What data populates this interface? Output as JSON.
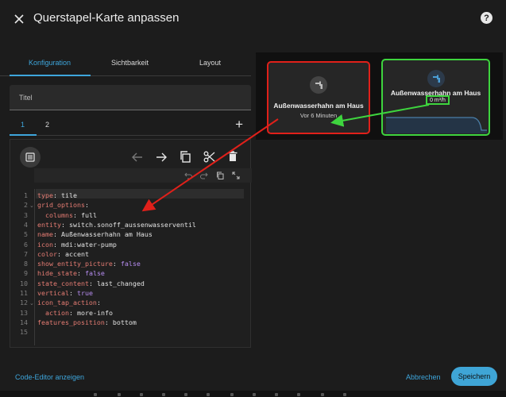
{
  "dialog": {
    "title": "Querstapel-Karte anpassen",
    "close_icon": "close-icon",
    "help_icon": "help-icon",
    "help_glyph": "?"
  },
  "tabs": [
    {
      "label": "Konfiguration",
      "active": true
    },
    {
      "label": "Sichtbarkeit",
      "active": false
    },
    {
      "label": "Layout",
      "active": false
    }
  ],
  "title_field": {
    "label": "Titel",
    "value": ""
  },
  "subtabs": [
    {
      "label": "1",
      "active": true
    },
    {
      "label": "2",
      "active": false
    }
  ],
  "add_glyph": "+",
  "toolbar": {
    "icons": [
      "card-picker-icon",
      "arrow-left-icon",
      "arrow-right-icon",
      "copy-icon",
      "cut-icon",
      "delete-icon"
    ],
    "secondary_icons": [
      "undo-icon",
      "redo-icon",
      "copy-small-icon",
      "fullscreen-icon"
    ]
  },
  "code": {
    "line_numbers": [
      "1",
      "2",
      "3",
      "4",
      "5",
      "6",
      "7",
      "8",
      "9",
      "10",
      "11",
      "12",
      "13",
      "14",
      "15"
    ],
    "lines": [
      {
        "indent": "",
        "key": "type",
        "sep": ": ",
        "value": "tile",
        "vtype": "str"
      },
      {
        "indent": "",
        "key": "grid_options",
        "sep": ":",
        "value": "",
        "vtype": "str"
      },
      {
        "indent": "  ",
        "key": "columns",
        "sep": ": ",
        "value": "full",
        "vtype": "str"
      },
      {
        "indent": "",
        "key": "entity",
        "sep": ": ",
        "value": "switch.sonoff_aussenwasserventil",
        "vtype": "str"
      },
      {
        "indent": "",
        "key": "name",
        "sep": ": ",
        "value": "Außenwasserhahn am Haus",
        "vtype": "str"
      },
      {
        "indent": "",
        "key": "icon",
        "sep": ": ",
        "value": "mdi:water-pump",
        "vtype": "str"
      },
      {
        "indent": "",
        "key": "color",
        "sep": ": ",
        "value": "accent",
        "vtype": "str"
      },
      {
        "indent": "",
        "key": "show_entity_picture",
        "sep": ": ",
        "value": "false",
        "vtype": "bool"
      },
      {
        "indent": "",
        "key": "hide_state",
        "sep": ": ",
        "value": "false",
        "vtype": "bool"
      },
      {
        "indent": "",
        "key": "state_content",
        "sep": ": ",
        "value": "last_changed",
        "vtype": "str"
      },
      {
        "indent": "",
        "key": "vertical",
        "sep": ": ",
        "value": "true",
        "vtype": "bool"
      },
      {
        "indent": "",
        "key": "icon_tap_action",
        "sep": ":",
        "value": "",
        "vtype": "str"
      },
      {
        "indent": "  ",
        "key": "action",
        "sep": ": ",
        "value": "more-info",
        "vtype": "str"
      },
      {
        "indent": "",
        "key": "features_position",
        "sep": ": ",
        "value": "bottom",
        "vtype": "str"
      },
      {
        "indent": "",
        "key": "",
        "sep": "",
        "value": "",
        "vtype": "str"
      }
    ],
    "fold_lines": [
      2,
      12
    ]
  },
  "preview": {
    "card_left": {
      "name": "Außenwasserhahn am Haus",
      "state": "Vor 6 Minuten",
      "icon": "water-pump-icon"
    },
    "card_right": {
      "name": "Außenwasserhahn am Haus",
      "state": "0 m³/h",
      "icon": "water-pump-icon",
      "chart_color": "#4a7ea8"
    }
  },
  "footer": {
    "code_editor_link": "Code-Editor anzeigen",
    "cancel": "Abbrechen",
    "save": "Speichern"
  },
  "colors": {
    "accent": "#3ea6dc",
    "annotation_red": "#e0201a",
    "annotation_green": "#3ed43e"
  }
}
